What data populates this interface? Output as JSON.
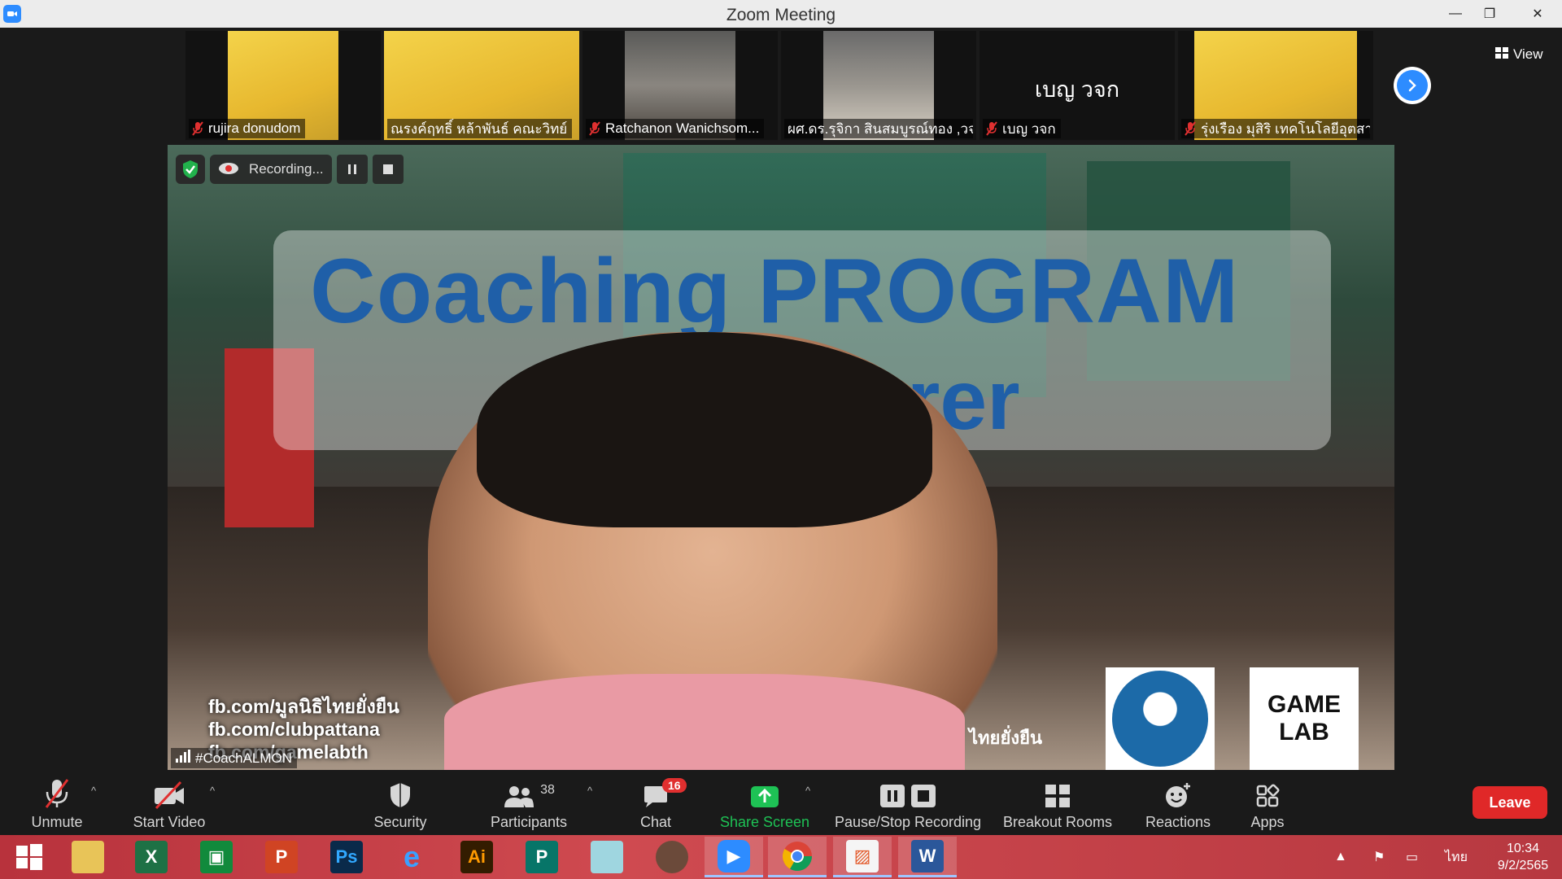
{
  "window": {
    "title": "Zoom Meeting"
  },
  "filmstrip": {
    "participants": [
      {
        "name": "rujira donudom",
        "muted": true
      },
      {
        "name": "ณรงค์ฤทธิ์ หล้าพันธ์ คณะวิทย์",
        "muted": false
      },
      {
        "name": "Ratchanon Wanichsom...",
        "muted": true
      },
      {
        "name": "ผศ.ดร.รุจิกา สินสมบูรณ์ทอง ,วจก",
        "muted": false
      },
      {
        "name": "เบญ วจก",
        "muted": true,
        "display_name": "เบญ วจก"
      },
      {
        "name": "รุ่งเรือง มุสิริ เทคโนโลยีอุตสา...",
        "muted": true
      }
    ],
    "view_label": "View"
  },
  "main_video": {
    "recording_label": "Recording...",
    "headline": "Coaching PROGRAM",
    "subline": "ecturer",
    "fb_lines": [
      "fb.com/มูลนิธิไทยยั่งยืน",
      "fb.com/clubpattana",
      "fb.com/gamelabth"
    ],
    "speaker_label": "#CoachALMON",
    "logos": {
      "thai": "ไทยยั่งยืน",
      "game1": "GAME",
      "game2": "LAB"
    }
  },
  "toolbar": {
    "unmute": "Unmute",
    "start_video": "Start Video",
    "security": "Security",
    "participants": "Participants",
    "participants_count": "38",
    "chat": "Chat",
    "chat_badge": "16",
    "share_screen": "Share Screen",
    "pause_stop_recording": "Pause/Stop Recording",
    "breakout_rooms": "Breakout Rooms",
    "reactions": "Reactions",
    "apps": "Apps",
    "leave": "Leave"
  },
  "taskbar": {
    "apps": [
      "start",
      "file-explorer",
      "excel",
      "store",
      "powerpoint",
      "photoshop",
      "internet-explorer",
      "illustrator",
      "publisher",
      "notepad",
      "photoscape",
      "zoom",
      "chrome",
      "paint",
      "word"
    ],
    "language": "ไทย",
    "time": "10:34",
    "date": "9/2/2565"
  },
  "colors": {
    "accent": "#2d8cff",
    "leave": "#e02828",
    "share": "#1ec255",
    "headline": "#1f5fa8"
  }
}
